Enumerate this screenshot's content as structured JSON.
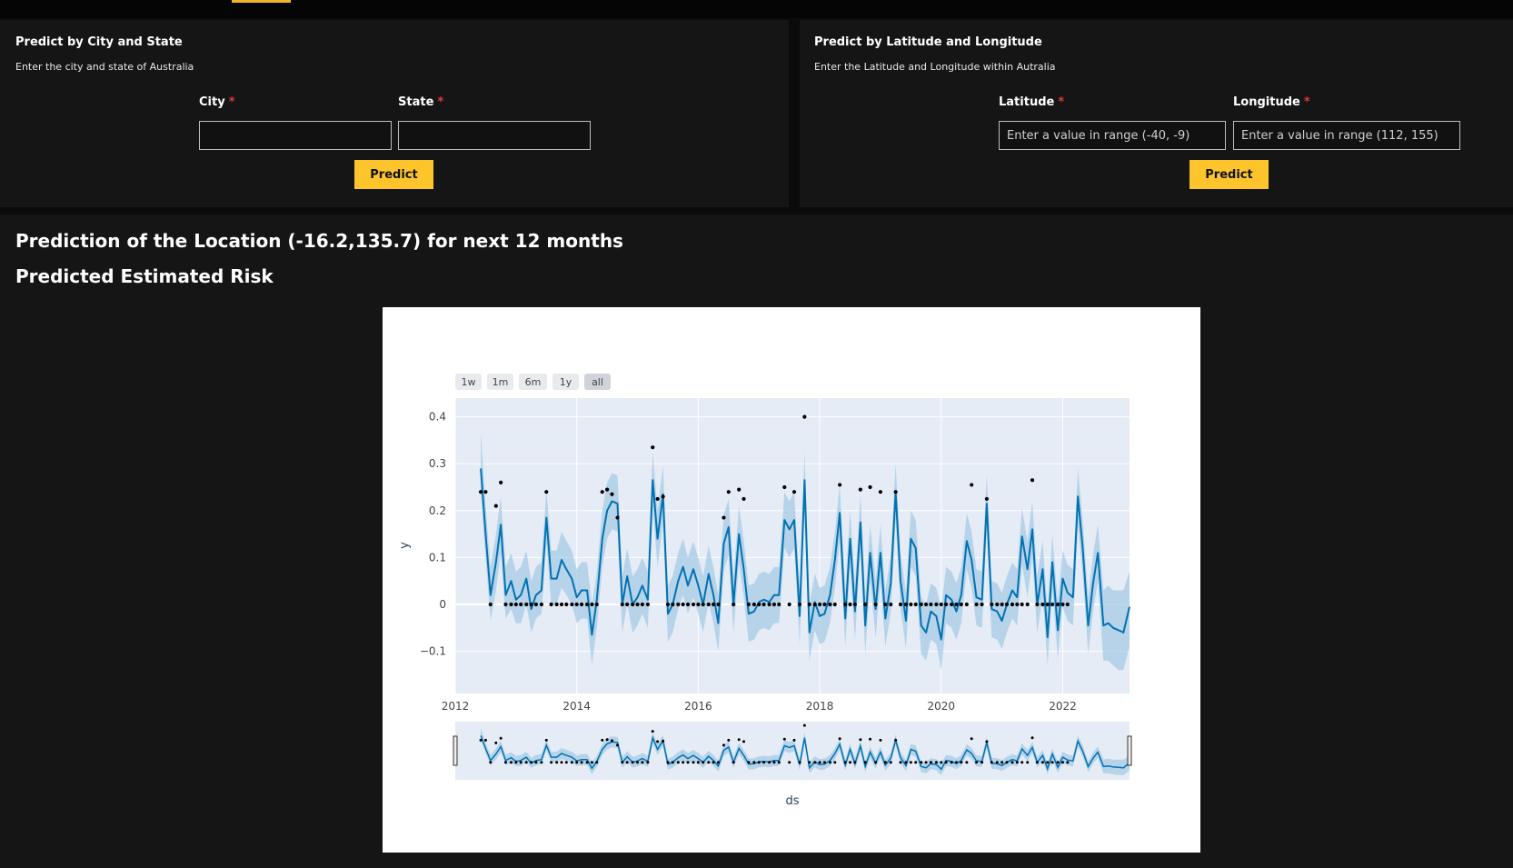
{
  "city_state_form": {
    "title": "Predict by City and State",
    "subtitle": "Enter the city and state of Australia",
    "city_label": "City",
    "state_label": "State",
    "required_marker": "*",
    "city_value": "",
    "state_value": "",
    "predict_label": "Predict"
  },
  "latlon_form": {
    "title": "Predict by Latitude and Longitude",
    "subtitle": "Enter the Latitude and Longitude within Autralia",
    "latitude_label": "Latitude",
    "longitude_label": "Longitude",
    "required_marker": "*",
    "latitude_placeholder": "Enter a value in range (-40, -9)",
    "longitude_placeholder": "Enter a value in range (112, 155)",
    "predict_label": "Predict"
  },
  "results": {
    "heading": "Prediction of the Location (-16.2,135.7) for next 12 months",
    "subheading": "Predicted Estimated Risk"
  },
  "colors": {
    "accent": "#fdc52b",
    "forecast_line": "#0072B2",
    "uncertainty_band": "#a6cbe6",
    "plot_background": "#e5ecf6"
  },
  "chart_data": {
    "type": "line",
    "xlabel": "ds",
    "ylabel": "y",
    "xlim": [
      2012,
      2023.1
    ],
    "ylim": [
      -0.19,
      0.44
    ],
    "x_ticks": [
      "2012",
      "2014",
      "2016",
      "2018",
      "2020",
      "2022"
    ],
    "y_ticks": [
      "0.4",
      "0.3",
      "0.2",
      "0.1",
      "0",
      "−0.1"
    ],
    "y_tick_values": [
      0.4,
      0.3,
      0.2,
      0.1,
      0,
      -0.1
    ],
    "range_selector": [
      "1w",
      "1m",
      "6m",
      "1y",
      "all"
    ],
    "range_selector_active": "all",
    "grid": true,
    "range_slider": true,
    "forecast": {
      "x": [
        2012.42,
        2012.5,
        2012.58,
        2012.67,
        2012.75,
        2012.83,
        2012.92,
        2013.0,
        2013.08,
        2013.17,
        2013.25,
        2013.33,
        2013.42,
        2013.5,
        2013.58,
        2013.67,
        2013.75,
        2013.83,
        2013.92,
        2014.0,
        2014.08,
        2014.17,
        2014.25,
        2014.33,
        2014.42,
        2014.5,
        2014.58,
        2014.67,
        2014.75,
        2014.83,
        2014.92,
        2015.0,
        2015.08,
        2015.17,
        2015.25,
        2015.33,
        2015.42,
        2015.5,
        2015.58,
        2015.67,
        2015.75,
        2015.83,
        2015.92,
        2016.0,
        2016.08,
        2016.17,
        2016.25,
        2016.33,
        2016.42,
        2016.5,
        2016.58,
        2016.67,
        2016.75,
        2016.83,
        2016.92,
        2017.0,
        2017.08,
        2017.17,
        2017.25,
        2017.33,
        2017.42,
        2017.5,
        2017.58,
        2017.67,
        2017.75,
        2017.83,
        2017.92,
        2018.0,
        2018.08,
        2018.17,
        2018.25,
        2018.33,
        2018.42,
        2018.5,
        2018.58,
        2018.67,
        2018.75,
        2018.83,
        2018.92,
        2019.0,
        2019.08,
        2019.17,
        2019.25,
        2019.33,
        2019.42,
        2019.5,
        2019.58,
        2019.67,
        2019.75,
        2019.83,
        2019.92,
        2020.0,
        2020.08,
        2020.17,
        2020.25,
        2020.33,
        2020.42,
        2020.5,
        2020.58,
        2020.67,
        2020.75,
        2020.83,
        2020.92,
        2021.0,
        2021.08,
        2021.17,
        2021.25,
        2021.33,
        2021.42,
        2021.5,
        2021.58,
        2021.67,
        2021.75,
        2021.83,
        2021.92,
        2022.0,
        2022.08,
        2022.17,
        2022.25,
        2022.33,
        2022.42,
        2022.5,
        2022.58,
        2022.67,
        2022.75,
        2022.83,
        2022.92,
        2023.0,
        2023.1
      ],
      "yhat": [
        0.29,
        0.15,
        0.02,
        0.09,
        0.17,
        0.02,
        0.05,
        0.01,
        0.02,
        0.055,
        -0.01,
        0.02,
        0.03,
        0.185,
        0.055,
        0.055,
        0.095,
        0.075,
        0.055,
        0.015,
        0.03,
        0.03,
        -0.065,
        0.01,
        0.14,
        0.2,
        0.22,
        0.215,
        0.0,
        0.06,
        0.0,
        0.015,
        0.04,
        0.01,
        0.265,
        0.14,
        0.235,
        -0.02,
        0.0,
        0.05,
        0.08,
        0.04,
        0.075,
        0.04,
        0.0,
        0.065,
        0.02,
        -0.04,
        0.13,
        0.165,
        0.0,
        0.15,
        0.075,
        -0.02,
        -0.015,
        0.005,
        0.01,
        0.005,
        0.02,
        0.02,
        0.18,
        0.16,
        0.18,
        -0.025,
        0.265,
        -0.06,
        0.005,
        -0.025,
        -0.02,
        0.02,
        0.095,
        0.195,
        -0.03,
        0.14,
        -0.015,
        0.175,
        -0.045,
        0.11,
        -0.01,
        0.11,
        -0.03,
        0.045,
        0.24,
        0.05,
        -0.035,
        0.14,
        0.12,
        -0.045,
        -0.06,
        -0.015,
        -0.025,
        -0.075,
        0.02,
        0.01,
        -0.015,
        0.02,
        0.135,
        0.095,
        0.015,
        0.01,
        0.215,
        -0.01,
        -0.015,
        -0.035,
        0.0,
        0.03,
        0.015,
        0.145,
        0.075,
        0.16,
        0.0,
        0.075,
        -0.07,
        0.09,
        -0.055,
        0.055,
        0.025,
        0.015,
        0.23,
        0.12,
        -0.045,
        0.045,
        0.11,
        -0.045,
        -0.04,
        -0.05,
        -0.055,
        -0.06,
        -0.005
      ],
      "yhat_lower": [
        0.24,
        0.1,
        -0.035,
        0.03,
        0.11,
        -0.03,
        -0.01,
        -0.04,
        -0.04,
        0.0,
        -0.06,
        -0.03,
        -0.02,
        0.13,
        0.0,
        0.0,
        0.035,
        0.02,
        0.0,
        -0.04,
        -0.03,
        -0.03,
        -0.13,
        -0.05,
        0.08,
        0.14,
        0.16,
        0.155,
        -0.06,
        0.0,
        -0.06,
        -0.045,
        -0.02,
        -0.05,
        0.205,
        0.08,
        0.175,
        -0.08,
        -0.06,
        -0.01,
        0.02,
        -0.02,
        0.015,
        -0.02,
        -0.06,
        0.005,
        -0.04,
        -0.1,
        0.07,
        0.105,
        -0.06,
        0.09,
        0.015,
        -0.08,
        -0.075,
        -0.055,
        -0.05,
        -0.055,
        -0.04,
        -0.04,
        0.12,
        0.1,
        0.12,
        -0.085,
        0.205,
        -0.12,
        -0.055,
        -0.085,
        -0.08,
        -0.04,
        0.035,
        0.135,
        -0.09,
        0.08,
        -0.075,
        0.115,
        -0.105,
        0.05,
        -0.07,
        0.05,
        -0.09,
        -0.015,
        0.18,
        -0.01,
        -0.095,
        0.08,
        0.06,
        -0.105,
        -0.12,
        -0.075,
        -0.085,
        -0.14,
        -0.04,
        -0.05,
        -0.075,
        -0.04,
        0.075,
        0.035,
        -0.045,
        -0.05,
        0.155,
        -0.07,
        -0.075,
        -0.095,
        -0.06,
        -0.03,
        -0.045,
        0.085,
        0.015,
        0.1,
        -0.06,
        0.015,
        -0.13,
        0.03,
        -0.115,
        -0.005,
        -0.035,
        -0.045,
        0.17,
        0.06,
        -0.105,
        -0.015,
        0.05,
        -0.12,
        -0.12,
        -0.13,
        -0.14,
        -0.14,
        -0.09
      ],
      "yhat_upper": [
        0.37,
        0.21,
        0.08,
        0.15,
        0.23,
        0.08,
        0.11,
        0.07,
        0.08,
        0.115,
        0.05,
        0.08,
        0.09,
        0.245,
        0.115,
        0.115,
        0.155,
        0.135,
        0.115,
        0.075,
        0.09,
        0.09,
        0.0,
        0.07,
        0.2,
        0.26,
        0.28,
        0.275,
        0.06,
        0.12,
        0.06,
        0.075,
        0.1,
        0.07,
        0.325,
        0.2,
        0.295,
        0.04,
        0.06,
        0.11,
        0.14,
        0.1,
        0.135,
        0.1,
        0.06,
        0.125,
        0.08,
        0.02,
        0.19,
        0.225,
        0.06,
        0.21,
        0.135,
        0.04,
        0.045,
        0.065,
        0.07,
        0.065,
        0.08,
        0.08,
        0.24,
        0.22,
        0.24,
        0.035,
        0.325,
        0.0,
        0.065,
        0.035,
        0.04,
        0.08,
        0.155,
        0.255,
        0.03,
        0.2,
        0.045,
        0.235,
        0.015,
        0.17,
        0.05,
        0.17,
        0.03,
        0.105,
        0.3,
        0.11,
        0.025,
        0.2,
        0.18,
        0.015,
        0.0,
        0.045,
        0.035,
        -0.01,
        0.08,
        0.07,
        0.045,
        0.08,
        0.195,
        0.155,
        0.075,
        0.07,
        0.275,
        0.05,
        0.045,
        0.025,
        0.06,
        0.09,
        0.075,
        0.205,
        0.135,
        0.22,
        0.06,
        0.135,
        -0.01,
        0.15,
        0.005,
        0.115,
        0.085,
        0.075,
        0.29,
        0.18,
        0.015,
        0.105,
        0.17,
        0.03,
        0.04,
        0.03,
        0.03,
        0.03,
        0.07
      ]
    },
    "observed": {
      "x": [
        2012.42,
        2012.5,
        2012.58,
        2012.67,
        2012.75,
        2012.83,
        2012.92,
        2013.0,
        2013.08,
        2013.17,
        2013.25,
        2013.33,
        2013.42,
        2013.5,
        2013.58,
        2013.67,
        2013.75,
        2013.83,
        2013.92,
        2014.0,
        2014.08,
        2014.17,
        2014.25,
        2014.33,
        2014.42,
        2014.5,
        2014.58,
        2014.67,
        2014.75,
        2014.83,
        2014.92,
        2015.0,
        2015.08,
        2015.17,
        2015.25,
        2015.33,
        2015.42,
        2015.5,
        2015.58,
        2015.67,
        2015.75,
        2015.83,
        2015.92,
        2016.0,
        2016.08,
        2016.17,
        2016.25,
        2016.33,
        2016.42,
        2016.5,
        2016.58,
        2016.67,
        2016.75,
        2016.83,
        2016.92,
        2017.0,
        2017.08,
        2017.17,
        2017.25,
        2017.33,
        2017.42,
        2017.5,
        2017.58,
        2017.67,
        2017.75,
        2017.83,
        2017.92,
        2018.0,
        2018.08,
        2018.17,
        2018.25,
        2018.33,
        2018.42,
        2018.5,
        2018.58,
        2018.67,
        2018.75,
        2018.83,
        2018.92,
        2019.0,
        2019.08,
        2019.17,
        2019.25,
        2019.33,
        2019.42,
        2019.5,
        2019.58,
        2019.67,
        2019.75,
        2019.83,
        2019.92,
        2020.0,
        2020.08,
        2020.17,
        2020.25,
        2020.33,
        2020.42,
        2020.5,
        2020.58,
        2020.67,
        2020.75,
        2020.83,
        2020.92,
        2021.0,
        2021.08,
        2021.17,
        2021.25,
        2021.33,
        2021.42,
        2021.5,
        2021.58,
        2021.67,
        2021.75,
        2021.83,
        2021.92,
        2022.0,
        2022.08
      ],
      "y": [
        0.24,
        0.24,
        0.0,
        0.21,
        0.26,
        0.0,
        0.0,
        0.0,
        0.0,
        0.0,
        0.0,
        0.0,
        0.0,
        0.24,
        0.0,
        0.0,
        0.0,
        0.0,
        0.0,
        0.0,
        0.0,
        0.0,
        0.0,
        0.0,
        0.24,
        0.245,
        0.235,
        0.185,
        0.0,
        0.0,
        0.0,
        0.0,
        0.0,
        0.0,
        0.335,
        0.225,
        0.23,
        0.0,
        0.0,
        0.0,
        0.0,
        0.0,
        0.0,
        0.0,
        0.0,
        0.0,
        0.0,
        0.0,
        0.185,
        0.24,
        0.0,
        0.245,
        0.225,
        0.0,
        0.0,
        0.0,
        0.0,
        0.0,
        0.0,
        0.0,
        0.25,
        0.0,
        0.24,
        0.0,
        0.4,
        0.0,
        0.0,
        0.0,
        0.0,
        0.0,
        0.0,
        0.255,
        0.0,
        0.0,
        0.0,
        0.245,
        0.0,
        0.25,
        0.0,
        0.24,
        0.0,
        0.0,
        0.24,
        0.0,
        0.0,
        0.0,
        0.0,
        0.0,
        0.0,
        0.0,
        0.0,
        0.0,
        0.0,
        0.0,
        0.0,
        0.0,
        0.0,
        0.255,
        0.0,
        0.0,
        0.225,
        0.0,
        0.0,
        0.0,
        0.0,
        0.0,
        0.0,
        0.0,
        0.0,
        0.265,
        0.0,
        0.0,
        0.0,
        0.0,
        0.0,
        0.0,
        0.0,
        0.0
      ]
    }
  }
}
